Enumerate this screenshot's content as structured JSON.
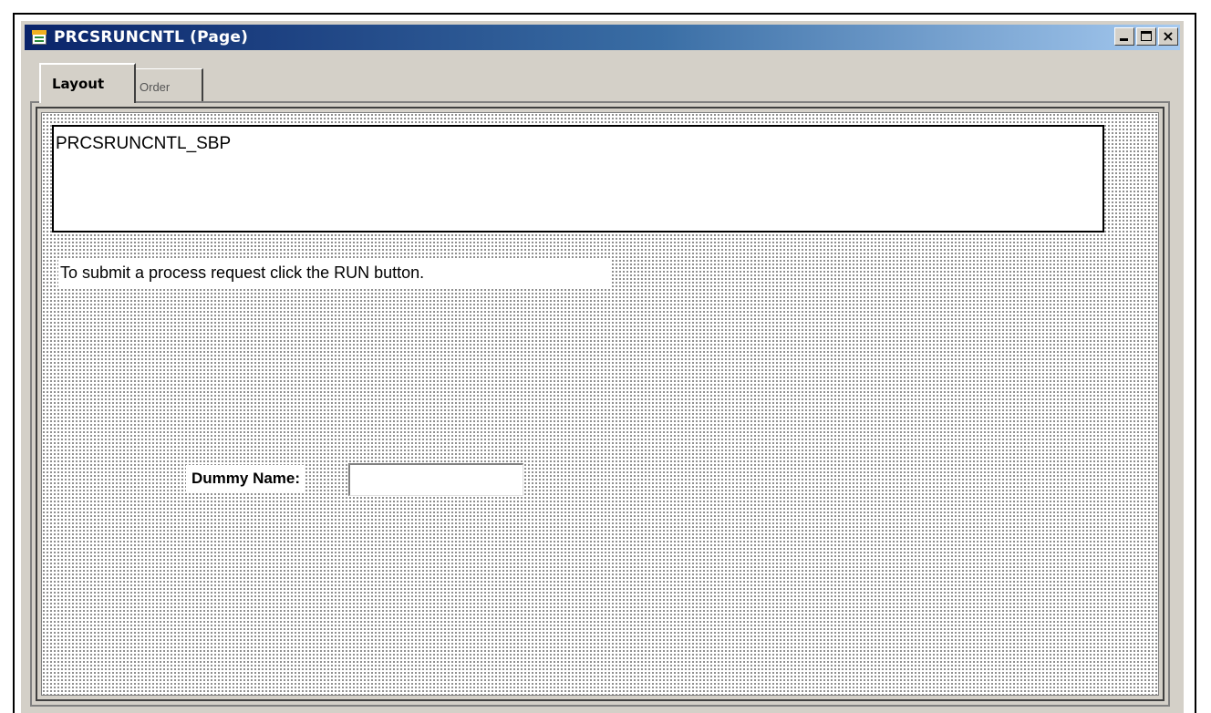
{
  "window": {
    "title": "PRCSRUNCNTL (Page)",
    "icon": "page-definition-icon",
    "controls": {
      "minimize": "minimize-icon",
      "maximize": "maximize-icon",
      "close": "close-icon"
    },
    "title_gradient": [
      "#0a246a",
      "#3a6ea5",
      "#a6caf0"
    ]
  },
  "tabs": [
    {
      "label": "Layout",
      "active": true
    },
    {
      "label": "Order",
      "active": false
    }
  ],
  "canvas": {
    "subpage": {
      "label": "PRCSRUNCNTL_SBP"
    },
    "instruction": {
      "text": "To submit a process request click the RUN button."
    },
    "field": {
      "label": "Dummy Name:",
      "value": ""
    }
  }
}
